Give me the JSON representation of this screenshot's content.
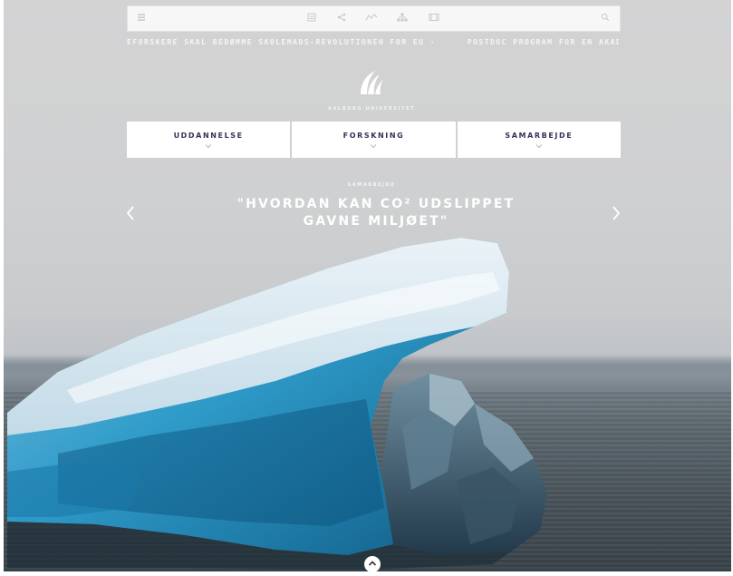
{
  "ticker": {
    "item1": "EFORSKERE SKAL BEDØMME SKOLEMADS-REVOLUTIONEN FOR EU ›",
    "item2": "POSTDOC PROGRAM FOR EN AKADEMISK"
  },
  "logo": {
    "text": "AALBORG UNIVERSITET"
  },
  "nav": {
    "items": [
      {
        "label": "UDDANNELSE"
      },
      {
        "label": "FORSKNING"
      },
      {
        "label": "SAMARBEJDE"
      }
    ]
  },
  "hero": {
    "kicker": "SAMARBEJDE",
    "line1": "\"HVORDAN KAN CO² UDSLIPPET",
    "line2": "GAVNE MILJØET\""
  },
  "icons": {
    "menu": "hamburger-menu-icon",
    "list": "list-icon",
    "share": "share-icon",
    "chart": "line-chart-icon",
    "org": "org-chart-icon",
    "film": "film-icon",
    "search": "search-icon",
    "prev": "chevron-left-icon",
    "next": "chevron-right-icon",
    "scroll": "chevron-up-icon"
  },
  "colors": {
    "nav_text": "#35305a",
    "topbar_bg": "#f7f7f7",
    "text_on_image": "#ffffff"
  }
}
